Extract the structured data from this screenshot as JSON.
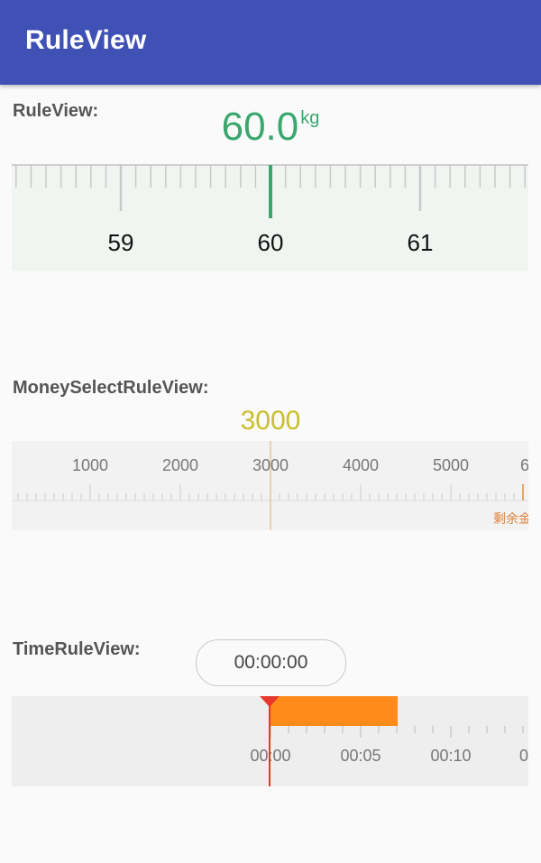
{
  "appbar": {
    "title": "RuleView"
  },
  "rule_view": {
    "label": "RuleView:",
    "value": "60.0",
    "unit": "kg",
    "major_labels": [
      "59",
      "60",
      "61"
    ],
    "accent_color": "#3aa76d"
  },
  "money_view": {
    "label": "MoneySelectRuleView:",
    "value": "3000",
    "tick_labels": [
      "1000",
      "2000",
      "3000",
      "4000",
      "5000",
      "6"
    ],
    "note": "剩余金",
    "accent_color": "#c9be2b",
    "note_color": "#e0823a"
  },
  "time_view": {
    "label": "TimeRuleView:",
    "current_time": "00:00:00",
    "tick_labels": [
      "00:00",
      "00:05",
      "00:10",
      "0"
    ],
    "cursor_color": "#e8372c",
    "segment_color": "#ff8c1a"
  }
}
